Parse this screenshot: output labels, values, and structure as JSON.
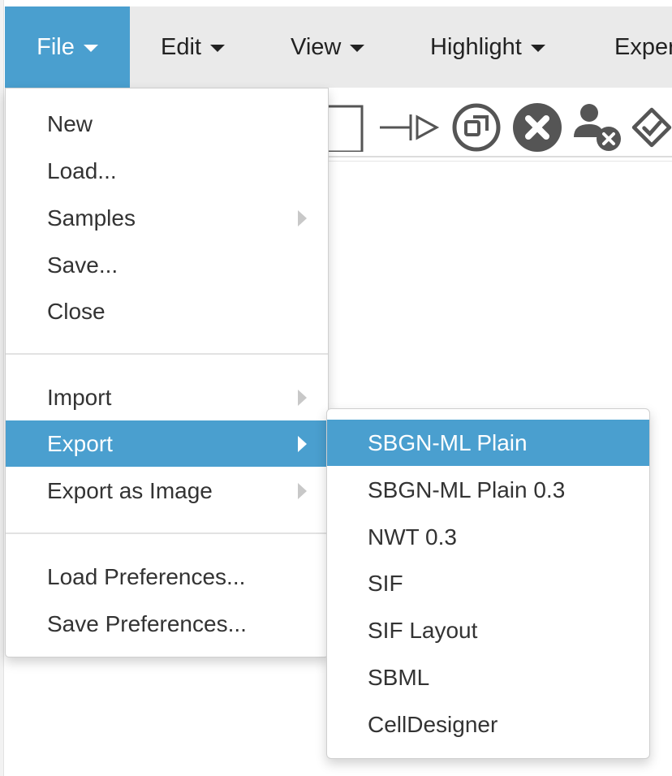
{
  "colors": {
    "accent": "#4a9fcf",
    "menubar_bg": "#eaeaea",
    "icon": "#555555"
  },
  "menubar": {
    "items": [
      {
        "label": "File",
        "active": true
      },
      {
        "label": "Edit"
      },
      {
        "label": "View"
      },
      {
        "label": "Highlight"
      },
      {
        "label": "Exper"
      }
    ]
  },
  "toolbar": {
    "icons": [
      "square-shape-icon",
      "inhibition-arrow-icon",
      "resize-icon",
      "delete-circle-icon",
      "remove-user-icon",
      "validate-icon"
    ]
  },
  "file_menu": {
    "groups": [
      [
        {
          "label": "New"
        },
        {
          "label": "Load..."
        },
        {
          "label": "Samples",
          "submenu": true
        },
        {
          "label": "Save..."
        },
        {
          "label": "Close"
        }
      ],
      [
        {
          "label": "Import",
          "submenu": true
        },
        {
          "label": "Export",
          "submenu": true,
          "active": true
        },
        {
          "label": "Export as Image",
          "submenu": true
        }
      ],
      [
        {
          "label": "Load Preferences..."
        },
        {
          "label": "Save Preferences..."
        }
      ]
    ]
  },
  "export_submenu": {
    "items": [
      {
        "label": "SBGN-ML Plain",
        "active": true
      },
      {
        "label": "SBGN-ML Plain 0.3"
      },
      {
        "label": "NWT 0.3"
      },
      {
        "label": "SIF"
      },
      {
        "label": "SIF Layout"
      },
      {
        "label": "SBML"
      },
      {
        "label": "CellDesigner"
      }
    ]
  }
}
